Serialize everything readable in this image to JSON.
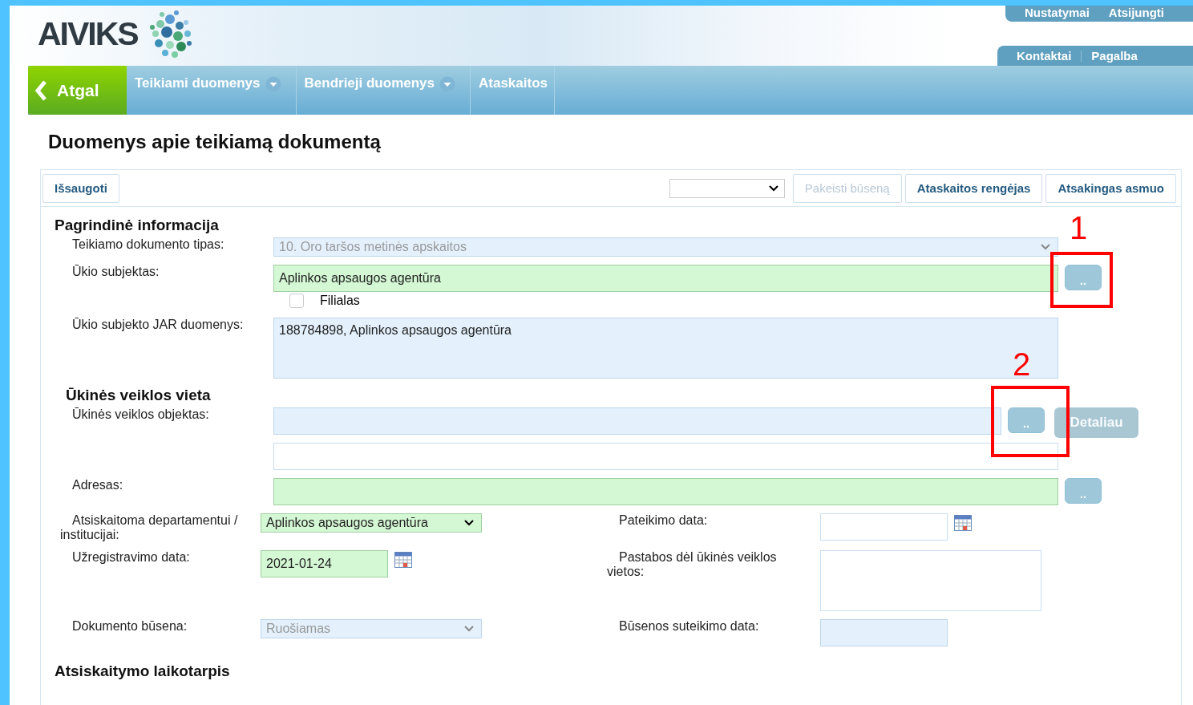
{
  "logo": {
    "text": "AIVIKS"
  },
  "top_links": [
    {
      "label": "Nustatymai"
    },
    {
      "label": "Atsijungti"
    }
  ],
  "secondary_links": [
    {
      "label": "Kontaktai"
    },
    {
      "label": "Pagalba"
    }
  ],
  "nav": {
    "back": "Atgal",
    "items": [
      {
        "label": "Teikiami duomenys",
        "dropdown": true
      },
      {
        "label": "Bendrieji duomenys",
        "dropdown": true
      },
      {
        "label": "Ataskaitos",
        "dropdown": false
      }
    ]
  },
  "page_title": "Duomenys apie teikiamą dokumentą",
  "toolbar": {
    "save": "Išsaugoti",
    "change_status": {
      "label": "Pakeisti būseną",
      "disabled": true
    },
    "buttons": [
      "Ataskaitos rengėjas",
      "Atsakingas asmuo"
    ]
  },
  "main_info": {
    "title": "Pagrindinė informacija",
    "rows": [
      {
        "label": "Teikiamo dokumento tipas:",
        "kind": "select",
        "required": false,
        "readonly": true,
        "disabled": true,
        "value": "10. Oro taršos metinės apskaitos"
      },
      {
        "label": "Ūkio subjektas:",
        "kind": "lookup",
        "required": true,
        "readonly": false,
        "value": "Aplinkos apsaugos agentūra",
        "button": "..",
        "annotation": "1",
        "checkbox": {
          "label": "Filialas",
          "checked": false
        }
      },
      {
        "label": "Ūkio subjekto JAR duomenys:",
        "kind": "textarea",
        "required": false,
        "readonly": true,
        "value": "188784898, Aplinkos apsaugos agentūra"
      }
    ]
  },
  "location": {
    "title": "Ūkinės veiklos vieta",
    "rows": [
      {
        "label": "Ūkinės veiklos objektas:",
        "kind": "lookup2",
        "required": false,
        "readonly": true,
        "button": "..",
        "annotation": "2",
        "extra_button": {
          "label": "Detaliau",
          "disabled": true
        }
      },
      {
        "label": "Adresas:",
        "kind": "lookup",
        "required": true,
        "readonly": false,
        "button": ".."
      }
    ],
    "pairs": [
      {
        "left": {
          "label": "Atsiskaitoma departamentui / institucijai:",
          "kind": "select",
          "required": true,
          "readonly": false,
          "disabled": false,
          "value": "Aplinkos apsaugos agentūra"
        },
        "right": {
          "label": "Pateikimo data:",
          "kind": "date",
          "required": false,
          "readonly": false
        }
      },
      {
        "left": {
          "label": "Užregistravimo data:",
          "kind": "date",
          "required": true,
          "readonly": false,
          "value": "2021-01-24"
        },
        "right": {
          "label": "Pastabos dėl ūkinės veiklos vietos:",
          "kind": "textarea",
          "required": false,
          "readonly": false
        }
      },
      {
        "left": {
          "label": "Dokumento būsena:",
          "kind": "select",
          "required": false,
          "readonly": true,
          "disabled": true,
          "value": "Ruošiamas"
        },
        "right": {
          "label": "Būsenos suteikimo data:",
          "kind": "input",
          "required": false,
          "readonly": true
        }
      }
    ]
  },
  "period": {
    "title": "Atsiskaitymo laikotarpis"
  }
}
